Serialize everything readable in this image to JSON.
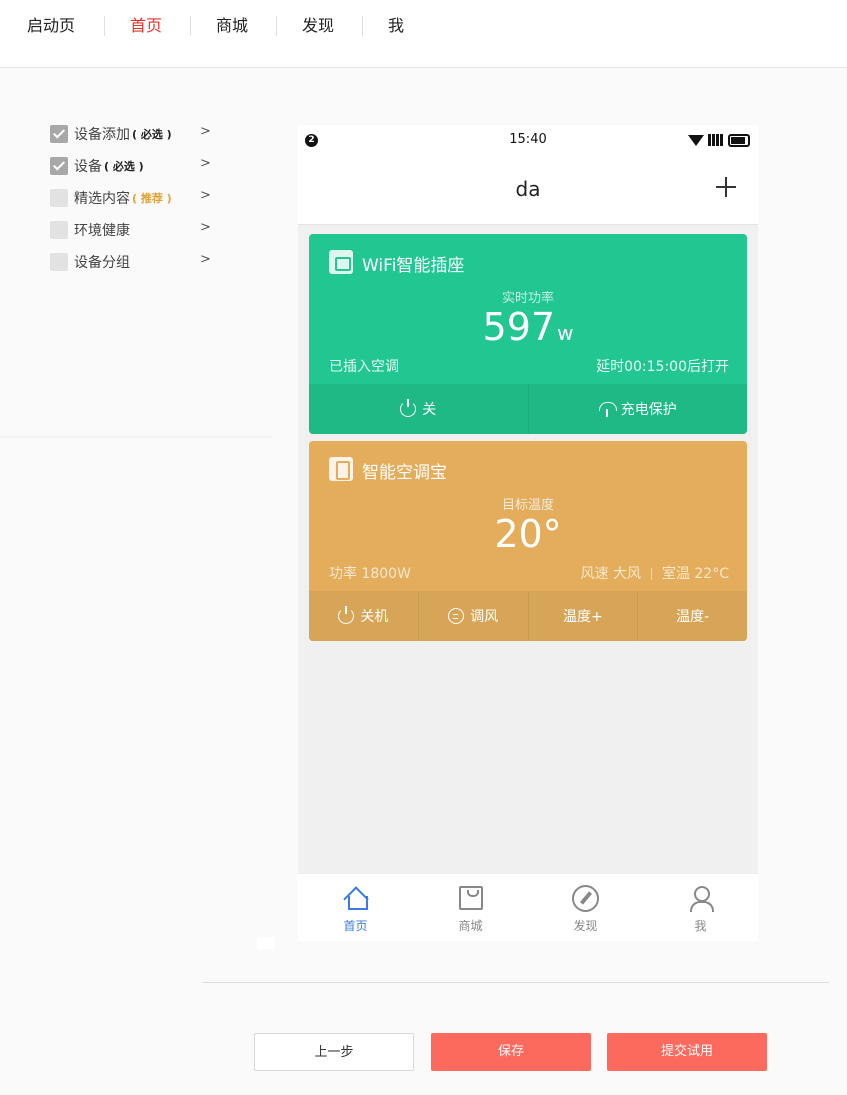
{
  "topnav": {
    "tabs": [
      {
        "label": "启动页"
      },
      {
        "label": "首页"
      },
      {
        "label": "商城"
      },
      {
        "label": "发现"
      },
      {
        "label": "我"
      }
    ],
    "active_index": 1,
    "active_color": "#e0342a"
  },
  "steps": [
    {
      "label": "设备添加",
      "tag": "( 必选 )",
      "checked": true,
      "arrow": ">"
    },
    {
      "label": "设备",
      "tag": "( 必选 )",
      "checked": true,
      "arrow": ">"
    },
    {
      "label": "精选内容",
      "tag": "( 推荐 )",
      "checked": false,
      "arrow": ">"
    },
    {
      "label": "环境健康",
      "tag": "",
      "checked": false,
      "arrow": ">"
    },
    {
      "label": "设备分组",
      "tag": "",
      "checked": false,
      "arrow": ">"
    }
  ],
  "phone": {
    "status": {
      "notif": "2",
      "time": "15:40"
    },
    "header": {
      "title": "da"
    },
    "card_plug": {
      "name": "WiFi智能插座",
      "sub_label": "实时功率",
      "value": "597",
      "unit": "w",
      "info_left": "已插入空调",
      "info_right": "延时00:15:00后打开",
      "actions": [
        "关",
        "充电保护"
      ],
      "color": "#21c690"
    },
    "card_ac": {
      "name": "智能空调宝",
      "sub_label": "目标温度",
      "value": "20°",
      "info_left": "功率 1800W",
      "info_right_a": "风速  大风",
      "info_right_b": "室温  22°C",
      "actions": [
        "关机",
        "调风",
        "温度+",
        "温度-"
      ],
      "color": "#e3ad5c"
    },
    "tabbar": [
      {
        "label": "首页",
        "icon": "home-icon"
      },
      {
        "label": "商城",
        "icon": "bag-icon"
      },
      {
        "label": "发现",
        "icon": "compass-icon"
      },
      {
        "label": "我",
        "icon": "user-icon"
      }
    ],
    "tabbar_active_color": "#3a7be8"
  },
  "buttons": {
    "prev": "上一步",
    "save": "保存",
    "submit": "提交试用",
    "accent": "#fc6a5e"
  }
}
